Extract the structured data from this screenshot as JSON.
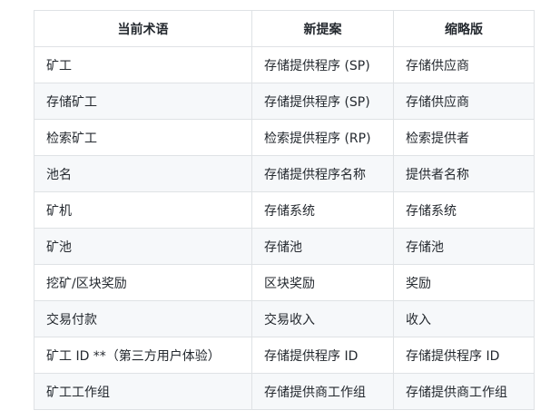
{
  "table": {
    "headers": [
      "当前术语",
      "新提案",
      "缩略版"
    ],
    "rows": [
      [
        "矿工",
        "存储提供程序 (SP)",
        "存储供应商"
      ],
      [
        "存储矿工",
        "存储提供程序 (SP)",
        "存储供应商"
      ],
      [
        "检索矿工",
        "检索提供程序 (RP)",
        "检索提供者"
      ],
      [
        "池名",
        "存储提供程序名称",
        "提供者名称"
      ],
      [
        "矿机",
        "存储系统",
        "存储系统"
      ],
      [
        "矿池",
        "存储池",
        "存储池"
      ],
      [
        "挖矿/区块奖励",
        "区块奖励",
        "奖励"
      ],
      [
        "交易付款",
        "交易收入",
        "收入"
      ],
      [
        "矿工 ID **（第三方用户体验）",
        "存储提供程序 ID",
        "存储提供程序 ID"
      ],
      [
        "矿工工作组",
        "存储提供商工作组",
        "存储提供商工作组"
      ]
    ]
  }
}
